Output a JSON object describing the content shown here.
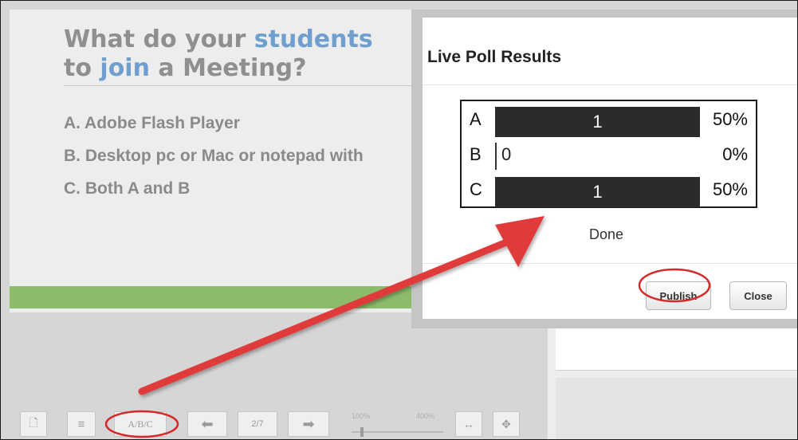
{
  "slide": {
    "title_line1_a": "What do your ",
    "title_line1_b": "students",
    "title_line2_a": "to ",
    "title_line2_b": "join",
    "title_line2_c": " a Meeting?",
    "options": [
      "A. Adobe Flash Player",
      "B. Desktop pc or Mac or notepad with",
      "C. Both A and B"
    ]
  },
  "dialog": {
    "title": "Live Poll Results",
    "results": [
      {
        "letter": "A",
        "count": "1",
        "percent": "50%",
        "fraction": 0.5
      },
      {
        "letter": "B",
        "count": "0",
        "percent": "0%",
        "fraction": 0
      },
      {
        "letter": "C",
        "count": "1",
        "percent": "50%",
        "fraction": 0.5
      }
    ],
    "status": "Done",
    "publish_label": "Publish",
    "close_label": "Close"
  },
  "toolbar": {
    "poll_label": "A/B/C",
    "page_indicator": "2/7",
    "zoom_min": "100%",
    "zoom_max": "400%",
    "zoom_level": 0.1,
    "fit_width_icon": "↔",
    "move_icon": "✥",
    "left_arrow_icon": "⬅",
    "right_arrow_icon": "➡"
  },
  "colors": {
    "annotation_red": "#e03a3a",
    "accent_blue": "#6f9fcf",
    "green_bar": "#8dbb6c",
    "bar_dark": "#2b2b2b"
  }
}
